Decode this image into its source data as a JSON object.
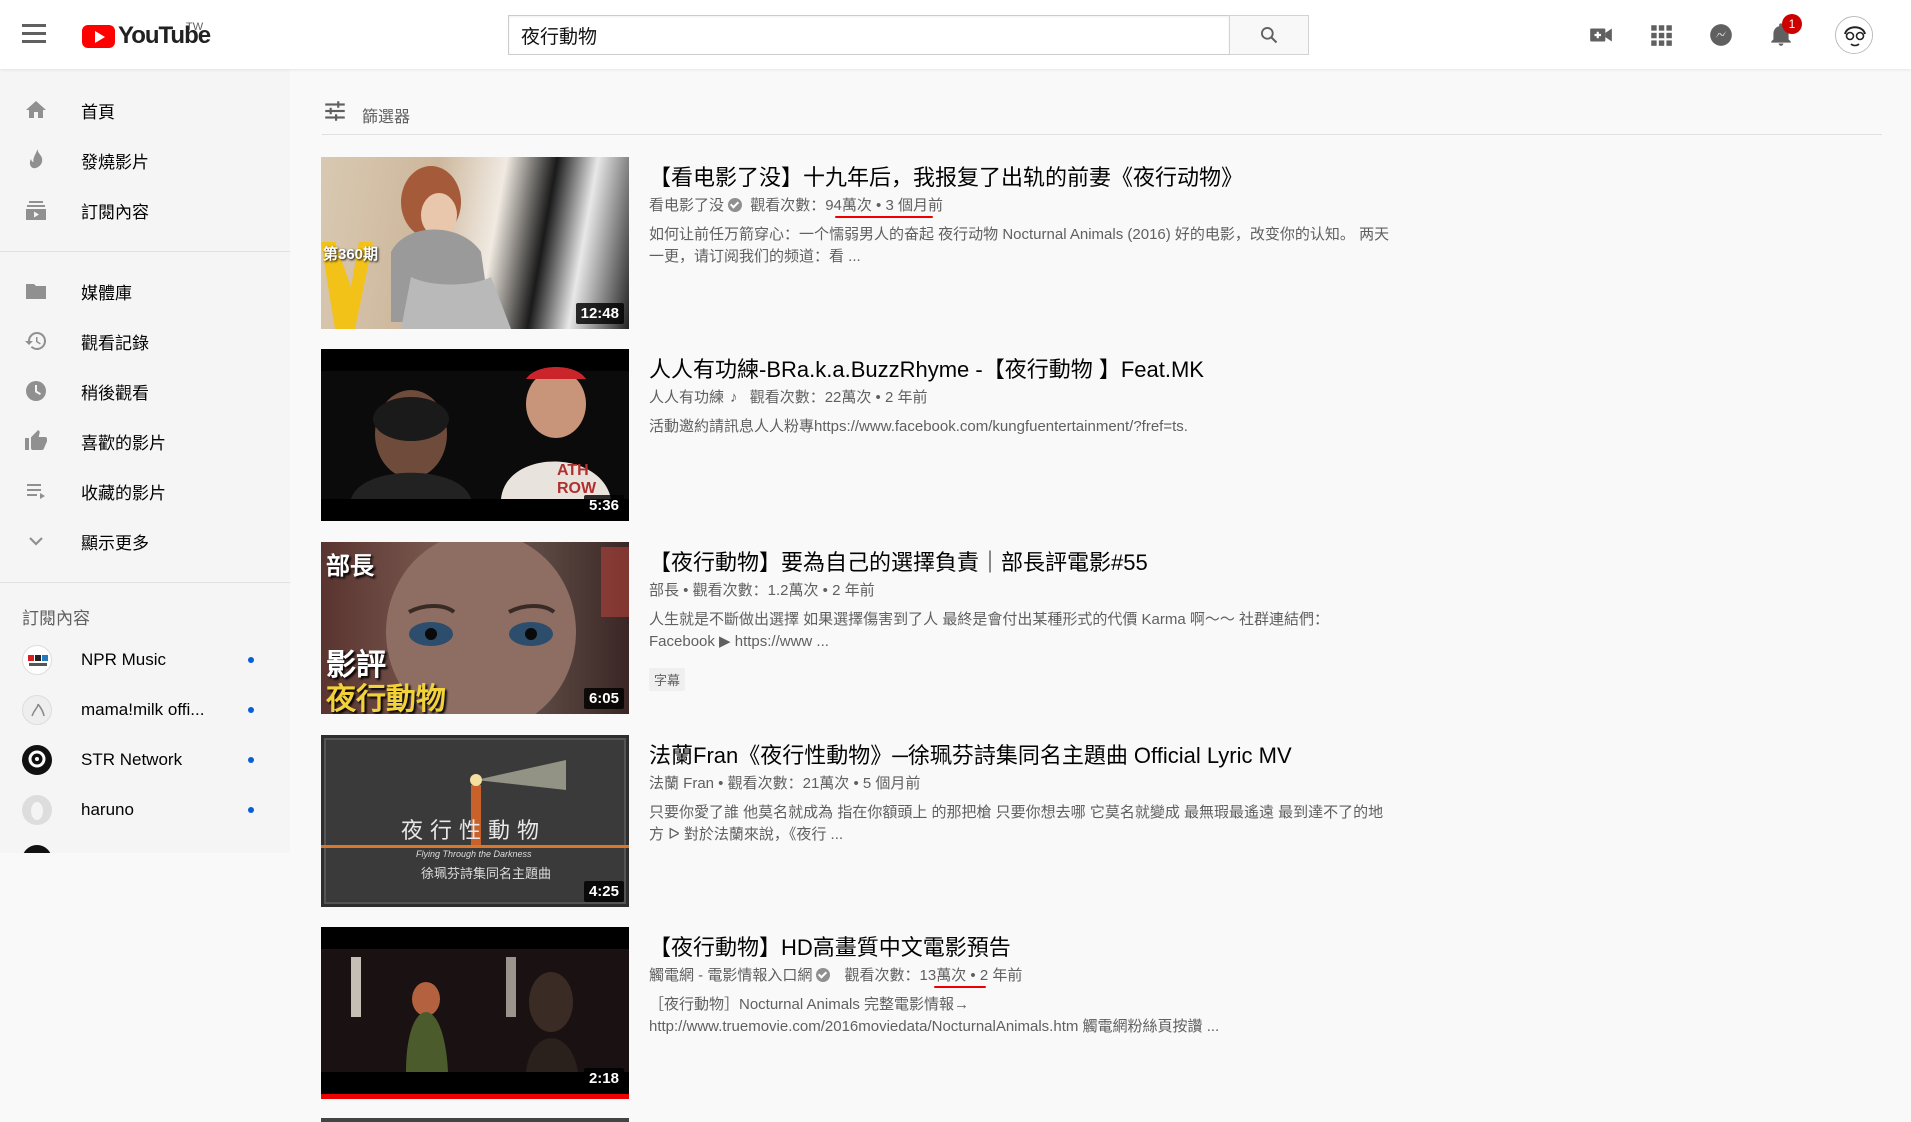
{
  "header": {
    "logo_text": "YouTube",
    "country": "TW",
    "search_value": "夜行動物",
    "notification_count": "1"
  },
  "sidebar": {
    "primary": [
      {
        "label": "首頁",
        "icon": "home-icon"
      },
      {
        "label": "發燒影片",
        "icon": "flame-icon"
      },
      {
        "label": "訂閱內容",
        "icon": "subscriptions-icon"
      }
    ],
    "library": [
      {
        "label": "媒體庫",
        "icon": "folder-icon"
      },
      {
        "label": "觀看記錄",
        "icon": "history-icon"
      },
      {
        "label": "稍後觀看",
        "icon": "clock-icon"
      },
      {
        "label": "喜歡的影片",
        "icon": "thumbs-up-icon"
      },
      {
        "label": "收藏的影片",
        "icon": "playlist-icon"
      },
      {
        "label": "顯示更多",
        "icon": "chevron-down-icon"
      }
    ],
    "subscriptions_heading": "訂閱內容",
    "subscriptions": [
      {
        "name": "NPR Music"
      },
      {
        "name": "mama!milk offi..."
      },
      {
        "name": "STR Network"
      },
      {
        "name": "haruno"
      }
    ]
  },
  "filter": {
    "label": "篩選器"
  },
  "videos": [
    {
      "title": "【看电影了没】十九年后，我报复了出轨的前妻《夜行动物》",
      "channel": "看电影了没",
      "views_label": "觀看次數：",
      "views": "94萬次",
      "age": "3 個月前",
      "desc": "如何让前任万箭穿心：一个懦弱男人的奋起 夜行动物 Nocturnal Animals (2016) 好的电影，改变你的认知。 两天一更，请订阅我们的频道：看 ...",
      "duration": "12:48",
      "thumb_text": "第360期"
    },
    {
      "title": "人人有功練-BRa.k.a.BuzzRhyme -【夜行動物 】Feat.MK",
      "channel": "人人有功練",
      "views_label": "觀看次數：",
      "views": "22萬次",
      "age": "2 年前",
      "desc": "活動邀約請訊息人人粉專https://www.facebook.com/kungfuentertainment/?fref=ts.",
      "duration": "5:36",
      "thumb_text": "ATH ROW"
    },
    {
      "title": "【夜行動物】要為自己的選擇負責｜部長評電影#55",
      "channel": "部長",
      "views_label": "觀看次數：",
      "views": "1.2萬次",
      "age": "2 年前",
      "desc": "人生就是不斷做出選擇 如果選擇傷害到了人 最終是會付出某種形式的代價 Karma 啊～～ 社群連結們：Facebook ▶ https://www ...",
      "tag": "字幕",
      "duration": "6:05",
      "thumb_text_1": "部長",
      "thumb_text_2": "影評",
      "thumb_text_3": "夜行動物"
    },
    {
      "title": "法蘭Fran《夜行性動物》─徐珮芬詩集同名主題曲 Official Lyric MV",
      "channel": "法蘭 Fran",
      "views_label": "觀看次數：",
      "views": "21萬次",
      "age": "5 個月前",
      "desc": "只要你愛了誰 他莫名就成為 指在你額頭上 的那把槍 只要你想去哪 它莫名就變成 最無瑕最遙遠 最到達不了的地方 ᐅ 對於法蘭來說，《夜行 ...",
      "duration": "4:25",
      "thumb_text_1": "夜 行 性 動 物",
      "thumb_text_2": "Flying Through the Darkness",
      "thumb_text_3": "徐珮芬詩集同名主題曲"
    },
    {
      "title": "【夜行動物】HD高畫質中文電影預告",
      "channel": "觸電網 - 電影情報入口網",
      "views_label": "觀看次數：",
      "views": "13萬次",
      "age": "2 年前",
      "desc": "［夜行動物］Nocturnal Animals 完整電影情報→ http://www.truemovie.com/2016moviedata/NocturnalAnimals.htm 觸電網粉絲頁按讚 ...",
      "duration": "2:18"
    }
  ],
  "colors": {
    "accent": "#ff0000",
    "badge": "#cc0000",
    "annotation": "#e00000",
    "link_dot": "#065fd4"
  }
}
